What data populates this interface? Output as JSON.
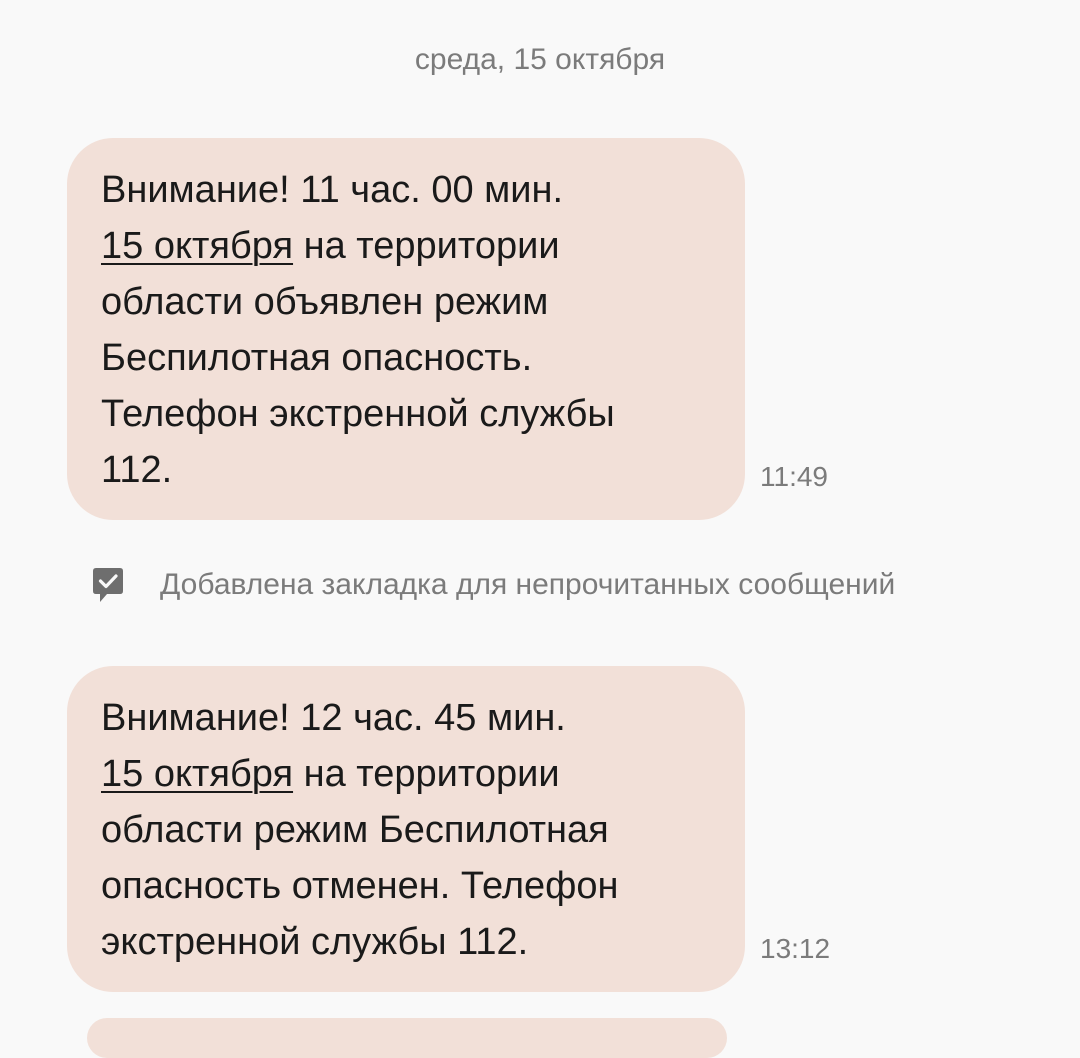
{
  "date_separator": "среда, 15 октября",
  "messages": [
    {
      "line1": "Внимание! 11 час. 00 мин.",
      "date_link": "15 октября",
      "after_link": " на территории",
      "line3": "области объявлен режим",
      "line4": "Беспилотная опасность.",
      "line5": "Телефон экстренной службы",
      "line6": "112.",
      "time": "11:49"
    },
    {
      "line1": "Внимание! 12 час. 45 мин.",
      "date_link": "15 октября",
      "after_link": " на территории",
      "line3": "области режим Беспилотная",
      "line4": "опасность отменен. Телефон",
      "line5": "экстренной службы 112.",
      "time": "13:12"
    }
  ],
  "bookmark": {
    "icon": "bookmark-check-icon",
    "text": "Добавлена закладка для непрочитанных сообщений"
  },
  "colors": {
    "background": "#f9f9f9",
    "bubble": "#f2e0d8",
    "text": "#1a1a1a",
    "secondary_text": "#7b7b7b"
  }
}
